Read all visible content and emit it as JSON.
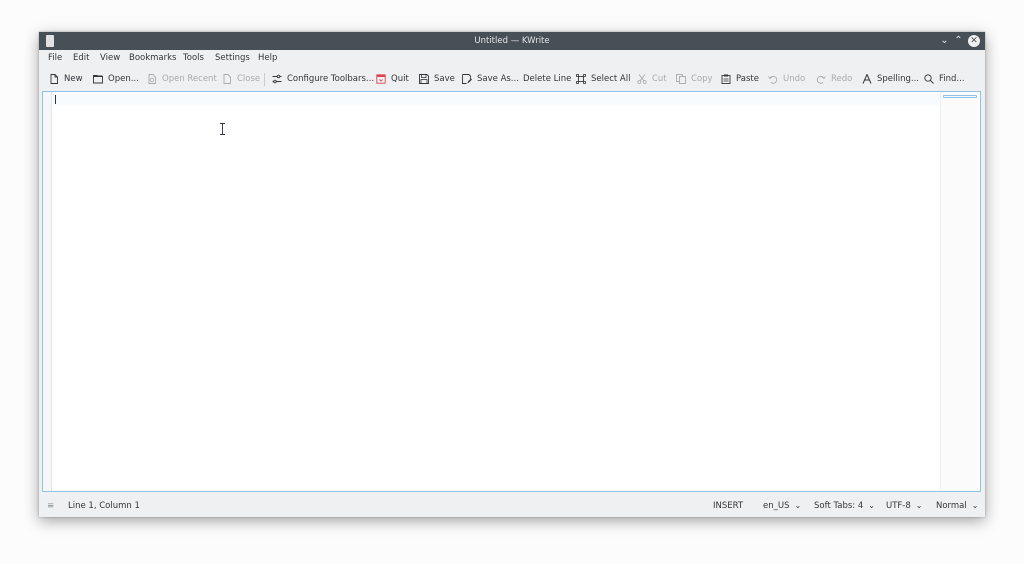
{
  "window": {
    "title": "Untitled — KWrite"
  },
  "menu": {
    "items": [
      "File",
      "Edit",
      "View",
      "Bookmarks",
      "Tools",
      "Settings",
      "Help"
    ]
  },
  "toolbar": {
    "new": "New",
    "open": "Open...",
    "open_recent": "Open Recent",
    "close": "Close",
    "configure_toolbars": "Configure Toolbars...",
    "quit": "Quit",
    "save": "Save",
    "save_as": "Save As...",
    "delete_line": "Delete Line",
    "select_all": "Select All",
    "cut": "Cut",
    "copy": "Copy",
    "paste": "Paste",
    "undo": "Undo",
    "redo": "Redo",
    "spelling": "Spelling...",
    "find": "Find..."
  },
  "statusbar": {
    "position": "Line 1, Column 1",
    "mode": "INSERT",
    "language": "en_US",
    "indent": "Soft Tabs: 4",
    "encoding": "UTF-8",
    "highlight": "Normal"
  },
  "colors": {
    "titlebar": "#475057",
    "accent": "#3daee9",
    "quit_icon": "#da4453"
  }
}
